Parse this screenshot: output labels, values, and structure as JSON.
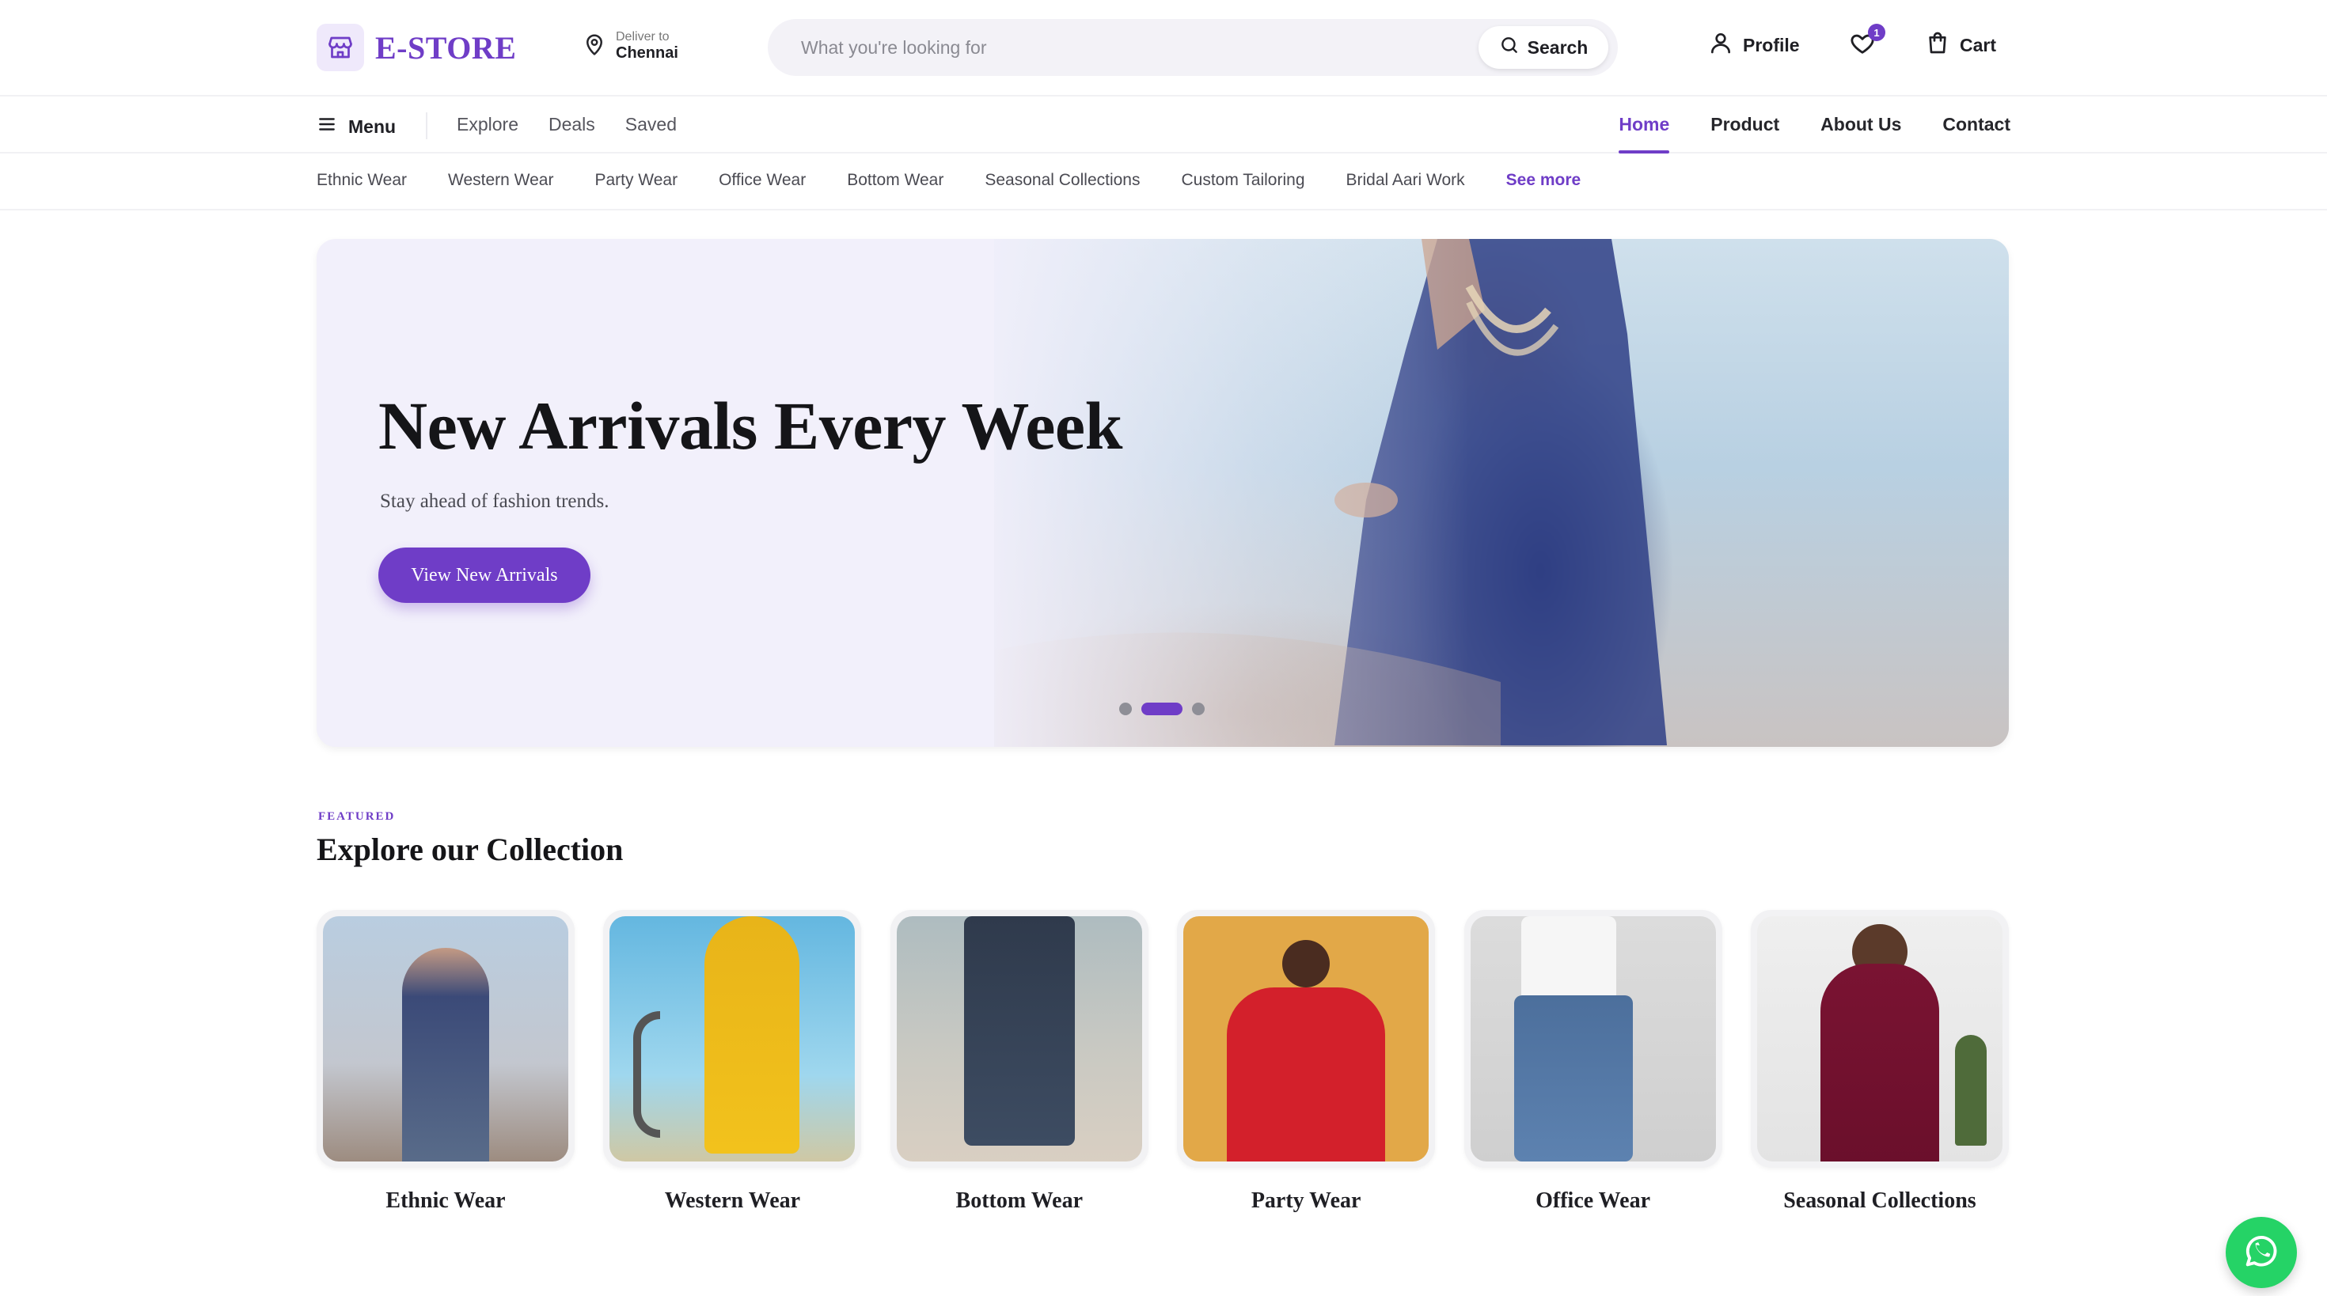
{
  "header": {
    "logo_text": "E-STORE",
    "deliver_label": "Deliver to",
    "deliver_city": "Chennai",
    "search_placeholder": "What you're looking for",
    "search_button": "Search",
    "profile_label": "Profile",
    "wishlist_count": "1",
    "cart_label": "Cart"
  },
  "nav": {
    "menu_label": "Menu",
    "left_links": [
      "Explore",
      "Deals",
      "Saved"
    ],
    "right_links": [
      "Home",
      "Product",
      "About Us",
      "Contact"
    ],
    "active": "Home"
  },
  "categories": {
    "items": [
      "Ethnic Wear",
      "Western Wear",
      "Party Wear",
      "Office Wear",
      "Bottom Wear",
      "Seasonal Collections",
      "Custom Tailoring",
      "Bridal Aari Work"
    ],
    "see_more": "See more"
  },
  "hero": {
    "title": "New Arrivals Every Week",
    "subtitle": "Stay ahead of fashion trends.",
    "cta": "View New Arrivals",
    "slides_total": 3,
    "active_slide": 2
  },
  "collection": {
    "eyebrow": "FEATURED",
    "title": "Explore our Collection",
    "cards": [
      {
        "label": "Ethnic Wear"
      },
      {
        "label": "Western Wear"
      },
      {
        "label": "Bottom Wear"
      },
      {
        "label": "Party Wear"
      },
      {
        "label": "Office Wear"
      },
      {
        "label": "Seasonal Collections"
      }
    ]
  },
  "icons": {
    "logo": "store-icon",
    "deliver": "location-pin-icon",
    "search": "search-icon",
    "profile": "user-icon",
    "wishlist": "heart-icon",
    "cart": "shopping-bag-icon",
    "menu": "hamburger-menu-icon",
    "chat": "whatsapp-icon"
  },
  "colors": {
    "accent": "#6f3dc7",
    "hero_bg": "#f2f0fb",
    "whatsapp": "#25d366"
  }
}
